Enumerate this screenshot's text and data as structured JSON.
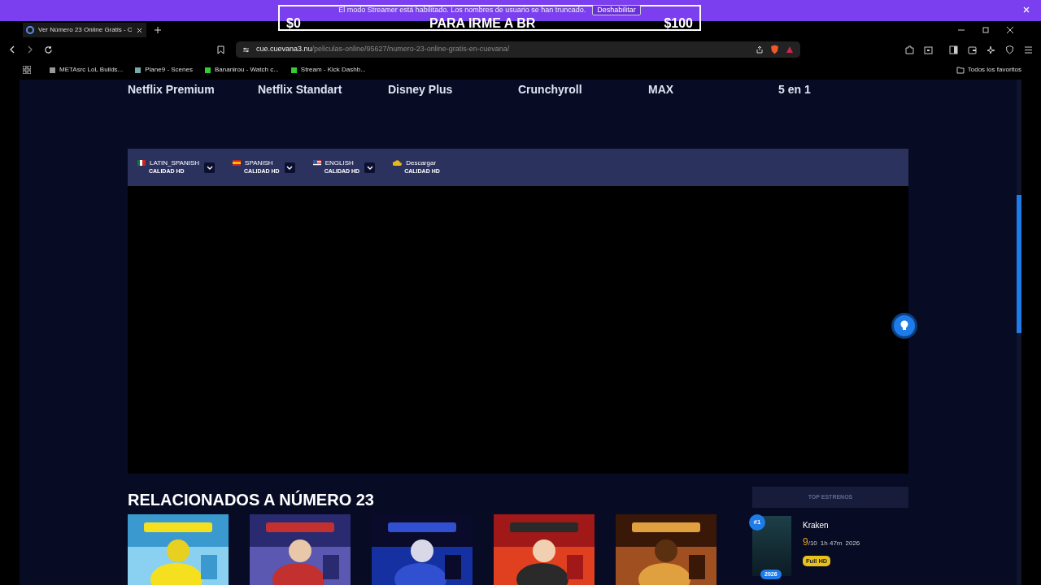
{
  "streamer_banner": {
    "message": "El modo Streamer está habilitado. Los nombres de usuario se han truncado.",
    "button": "Deshabilitar"
  },
  "goal_overlay": {
    "start": "$0",
    "title": "PARA IRME A BR",
    "end": "$100"
  },
  "browser": {
    "tabs": [
      {
        "title": "Ver Número 23 Online Gratis - C",
        "selected": true
      }
    ],
    "url_host": "cue.cuevana3.nu",
    "url_path": "/peliculas-online/95627/numero-23-online-gratis-en-cuevana/",
    "bookmarks": [
      {
        "label": "METAsrc LoL Builds..."
      },
      {
        "label": "Plane9 - Scenes"
      },
      {
        "label": "Bananirou - Watch c..."
      },
      {
        "label": "Stream - Kick Dashb..."
      }
    ],
    "favorites": "Todos los favoritos"
  },
  "services": [
    "Netflix Premium",
    "Netflix Standart",
    "Disney Plus",
    "Crunchyroll",
    "MAX",
    "5 en 1"
  ],
  "player": {
    "sources": [
      {
        "kind": "language",
        "label": "LATIN_SPANISH",
        "quality": "CALIDAD HD"
      },
      {
        "kind": "language",
        "label": "SPANISH",
        "quality": "CALIDAD HD"
      },
      {
        "kind": "language",
        "label": "ENGLISH",
        "quality": "CALIDAD HD"
      },
      {
        "kind": "download",
        "label": "Descargar",
        "quality": "CALIDAD HD"
      }
    ]
  },
  "related": {
    "title": "RELACIONADOS A NÚMERO 23"
  },
  "top": {
    "title": "TOP ESTRENOS",
    "items": [
      {
        "rank": "#1",
        "title": "Kraken",
        "score": "9",
        "score_max": "/10",
        "duration": "1h 47m",
        "year": "2026",
        "badge": "Full HD",
        "poster_year": "2026"
      }
    ]
  }
}
